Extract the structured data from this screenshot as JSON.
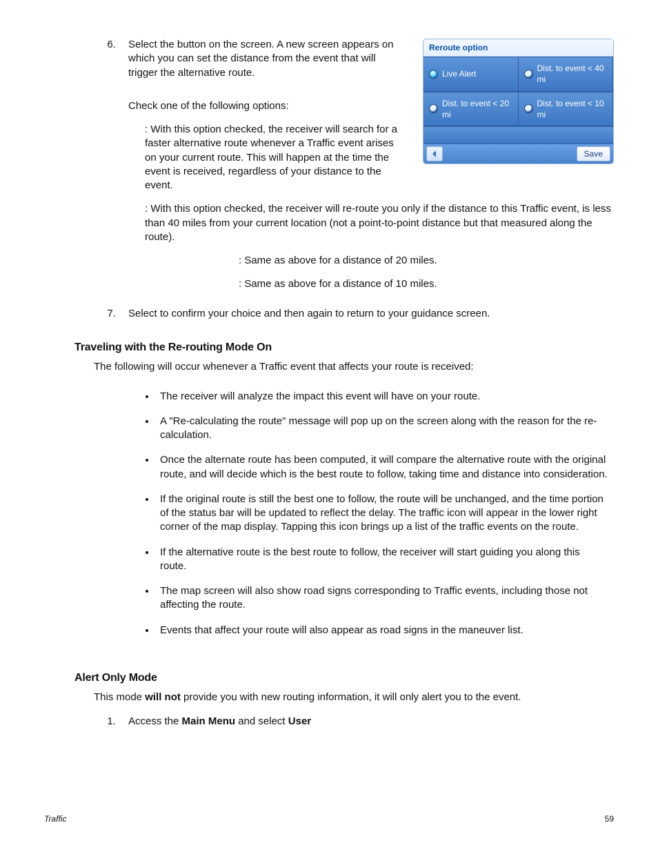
{
  "shot": {
    "title": "Reroute option",
    "options": {
      "live": "Live Alert",
      "d40": "Dist. to event < 40 mi",
      "d20": "Dist. to event < 20 mi",
      "d10": "Dist. to event < 10 mi"
    },
    "save": "Save"
  },
  "step6": {
    "intro_a": "Select the ",
    "intro_b": " button on the screen. A new screen appears on which you can set the distance from the event that will trigger the alternative route.",
    "check": "Check one of the following options:",
    "opt_live": ": With this option checked, the receiver will search for a faster alternative route whenever a Traffic event arises on your current route. This will happen at the time the event is received, regardless of your distance to the event.",
    "opt_40": ": With this option checked, the receiver will re-route you only if the distance to this Traffic event, is less than 40 miles from your current location (not a point-to-point distance but that measured along the route).",
    "opt_20": ": Same as above for a distance of 20 miles.",
    "opt_10": ": Same as above for a distance of 10 miles."
  },
  "step7": {
    "a": "Select ",
    "b": " to confirm your choice and then ",
    "c": " again to return to your guidance screen."
  },
  "traveling": {
    "heading": "Traveling with the Re-routing Mode On",
    "intro": "The following will occur whenever a Traffic event that affects your route is received:",
    "items": [
      "The receiver will analyze the impact this event will have on your route.",
      "A \"Re-calculating the route\" message will pop up on the screen along with the reason for the re-calculation.",
      "Once the alternate route has been computed, it will compare the alternative route with the original route, and will decide which is the best route to follow, taking time and distance into consideration.",
      "If the original route is still the best one to follow, the route will be unchanged, and the time portion of the status bar will be updated to reflect the delay. The traffic icon will appear in the lower right corner of the map display.  Tapping this icon brings up a list of the traffic events on the route.",
      "If the alternative route is the best route to follow, the receiver will start guiding you along this route.",
      "The map screen will also show road signs corresponding to Traffic events, including those not affecting the route.",
      "Events that affect your route will also appear as road signs in the maneuver list."
    ]
  },
  "alert": {
    "heading": "Alert Only Mode",
    "intro_a": "This mode ",
    "intro_b": "will not",
    "intro_c": " provide you with new routing information, it will only alert you to the event.",
    "step1_a": "Access the ",
    "step1_b": "Main Menu",
    "step1_c": " and select ",
    "step1_d": "User"
  },
  "footer": {
    "section": "Traffic",
    "page": "59"
  }
}
